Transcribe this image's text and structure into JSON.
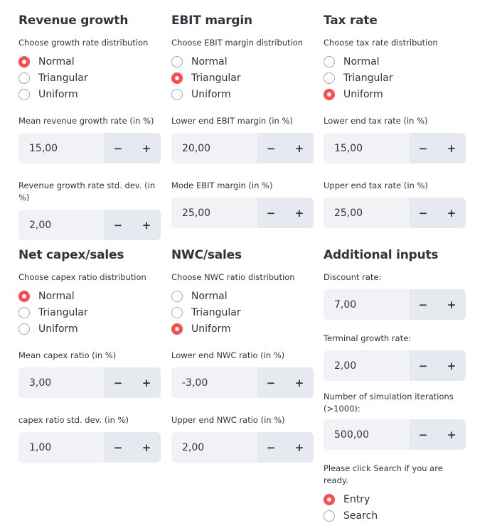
{
  "sections": {
    "revenue": {
      "title": "Revenue growth",
      "dist_label": "Choose growth rate distribution",
      "options": [
        "Normal",
        "Triangular",
        "Uniform"
      ],
      "selected": "Normal",
      "field1_label": "Mean revenue growth rate (in %)",
      "field1_value": "15,00",
      "field2_label": "Revenue growth rate std. dev. (in %)",
      "field2_value": "2,00"
    },
    "ebit": {
      "title": "EBIT margin",
      "dist_label": "Choose EBIT margin distribution",
      "options": [
        "Normal",
        "Triangular",
        "Uniform"
      ],
      "selected": "Triangular",
      "field1_label": "Lower end EBIT margin (in %)",
      "field1_value": "20,00",
      "field2_label": "Mode EBIT margin (in %)",
      "field2_value": "25,00"
    },
    "tax": {
      "title": "Tax rate",
      "dist_label": "Choose tax rate distribution",
      "options": [
        "Normal",
        "Triangular",
        "Uniform"
      ],
      "selected": "Uniform",
      "field1_label": "Lower end tax rate (in %)",
      "field1_value": "15,00",
      "field2_label": "Upper end tax rate (in %)",
      "field2_value": "25,00"
    },
    "capex": {
      "title": "Net capex/sales",
      "dist_label": "Choose capex ratio distribution",
      "options": [
        "Normal",
        "Triangular",
        "Uniform"
      ],
      "selected": "Normal",
      "field1_label": "Mean capex ratio (in %)",
      "field1_value": "3,00",
      "field2_label": "capex ratio std. dev. (in %)",
      "field2_value": "1,00"
    },
    "nwc": {
      "title": "NWC/sales",
      "dist_label": "Choose NWC ratio distribution",
      "options": [
        "Normal",
        "Triangular",
        "Uniform"
      ],
      "selected": "Uniform",
      "field1_label": "Lower end NWC ratio (in %)",
      "field1_value": "-3,00",
      "field2_label": "Upper end NWC ratio (in %)",
      "field2_value": "2,00"
    }
  },
  "additional": {
    "title": "Additional inputs",
    "discount_label": "Discount rate:",
    "discount_value": "7,00",
    "terminal_label": "Terminal growth rate:",
    "terminal_value": "2,00",
    "iterations_label": "Number of simulation iterations (>1000):",
    "iterations_value": "500,00",
    "search_prompt": "Please click Search if you are ready.",
    "options": [
      "Entry",
      "Search"
    ],
    "selected": "Entry"
  },
  "stepper": {
    "minus": "−",
    "plus": "+"
  },
  "colors": {
    "accent": "#ff4b4b",
    "input_bg": "#f0f2f6",
    "button_bg": "#e6e9ef",
    "text": "#31333f"
  }
}
